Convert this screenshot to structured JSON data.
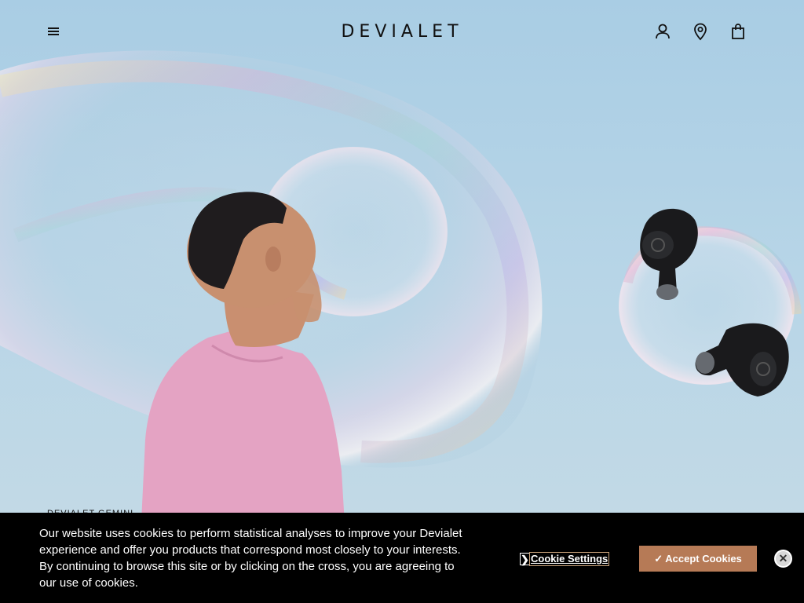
{
  "header": {
    "logo_text": "DEVIALET",
    "icons": [
      "menu-icon",
      "account-icon",
      "location-icon",
      "bag-icon"
    ]
  },
  "hero": {
    "product_tag": "DEVIALET GEMINI"
  },
  "cookie_banner": {
    "message": "Our website uses cookies to perform statistical analyses to improve your Devialet experience and offer you products that correspond most closely to your interests. By continuing to browse this site or by clicking on the cross, you are agreeing to our use of cookies.",
    "settings_chevron": "❯",
    "settings_label": "Cookie Settings",
    "accept_label": "✓ Accept Cookies",
    "close_symbol": "✕",
    "accent_color": "#b67a56"
  }
}
